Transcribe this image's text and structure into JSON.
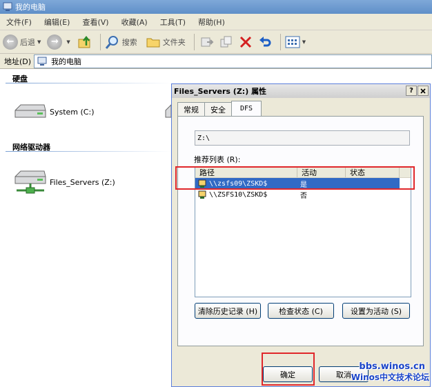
{
  "window": {
    "title": "我的电脑"
  },
  "menu": [
    "文件(F)",
    "编辑(E)",
    "查看(V)",
    "收藏(A)",
    "工具(T)",
    "帮助(H)"
  ],
  "toolbar": {
    "back": "后退",
    "search": "搜索",
    "folders": "文件夹"
  },
  "address": {
    "label": "地址(D)",
    "value": "我的电脑"
  },
  "groups": {
    "hard_disks": {
      "title": "硬盘",
      "drives": [
        "System (C:)"
      ]
    },
    "network": {
      "title": "网络驱动器",
      "drives": [
        "Files_Servers (Z:)"
      ]
    }
  },
  "dialog": {
    "title": "Files_Servers (Z:) 属性",
    "help_btn": "?",
    "close_btn": "X",
    "tabs": [
      "常规",
      "安全",
      "DFS"
    ],
    "active_tab": "DFS",
    "path": "Z:\\",
    "referral_label": "推荐列表 (R):",
    "columns": [
      "路径",
      "活动",
      "状态"
    ],
    "rows": [
      {
        "path": "\\\\zsfs09\\ZSKD$",
        "active": "是",
        "status": "",
        "selected": true
      },
      {
        "path": "\\\\ZSFS10\\ZSKD$",
        "active": "否",
        "status": "",
        "selected": false
      }
    ],
    "buttons": {
      "clear_history": "清除历史记录 (H)",
      "check_status": "检查状态 (C)",
      "set_active": "设置为活动 (S)"
    },
    "ok": "确定",
    "cancel": "取消"
  },
  "watermark": {
    "line1": "bbs.winos.cn",
    "line2": "Winos中文技术论坛"
  },
  "colors": {
    "selection": "#316ac5",
    "highlight_box": "#e0262a",
    "title_blue": "#5f8fc8"
  }
}
